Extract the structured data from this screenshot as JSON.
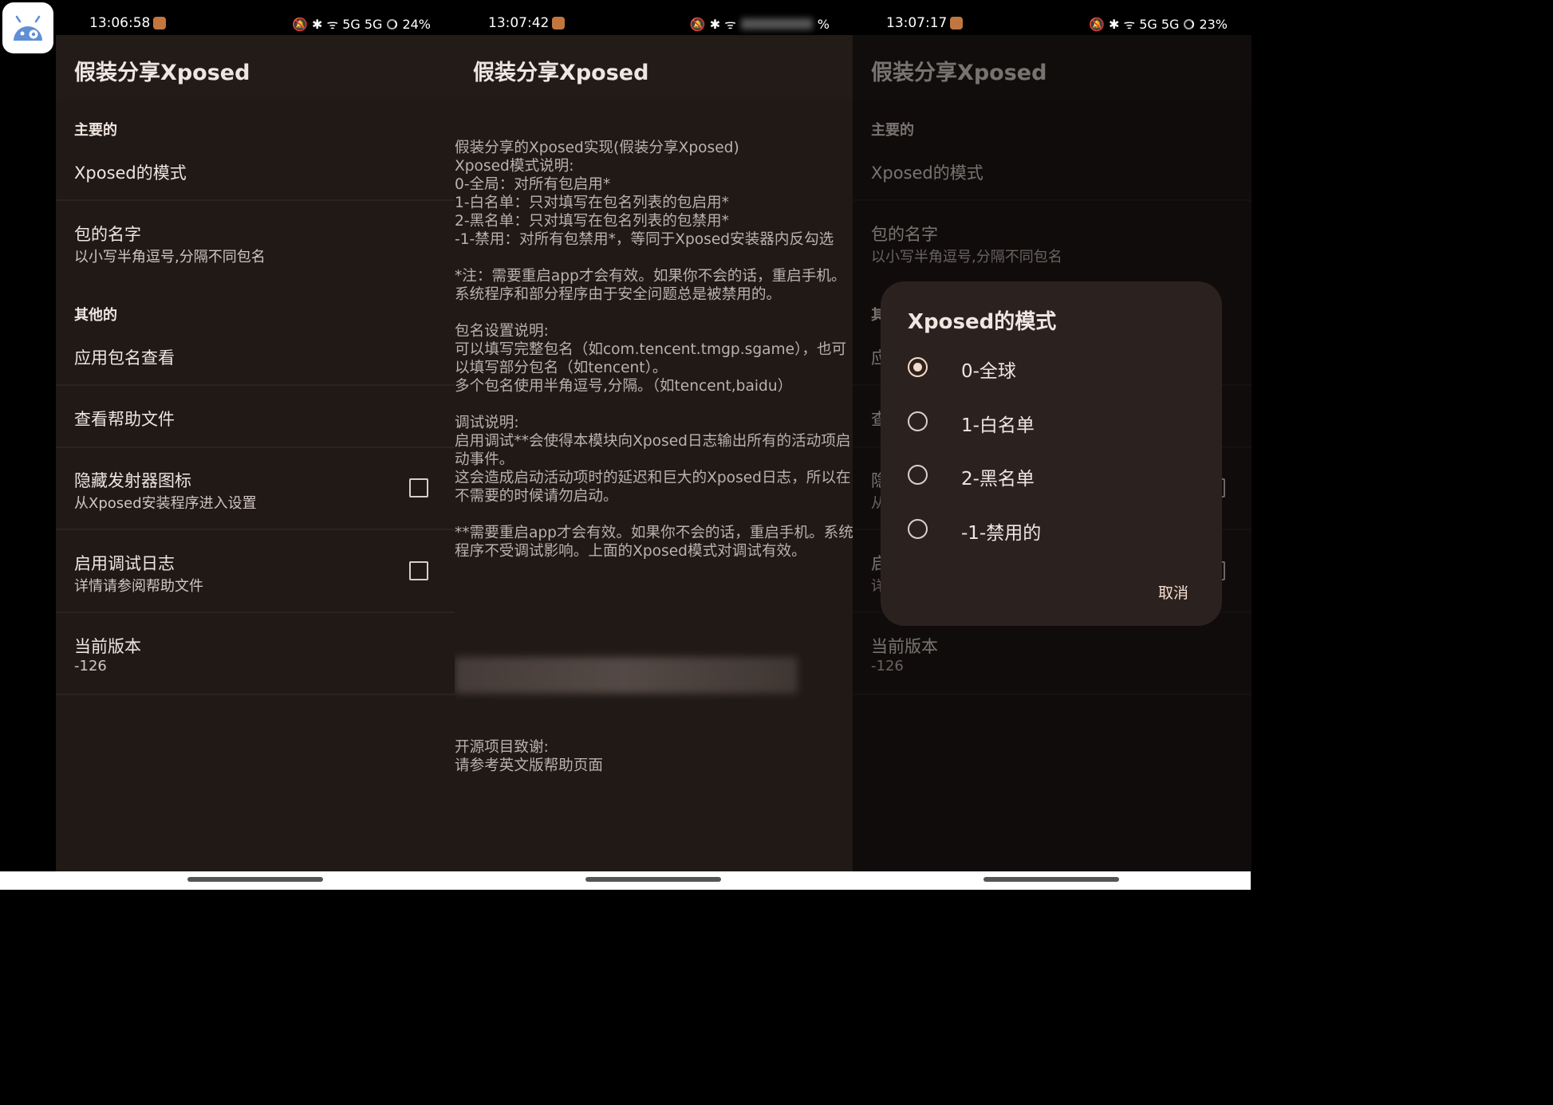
{
  "colors": {
    "background": "#201916",
    "accent": "#f7d9c4",
    "statusbar": "#000000"
  },
  "launcher_icon": {
    "name": "android-settings-icon"
  },
  "screens": [
    {
      "status": {
        "time": "13:06:58",
        "battery": "24%",
        "icons": "🔕 ✱ ᯤ 5G 5G"
      },
      "app_title": "假装分享Xposed",
      "categories": {
        "main": "主要的",
        "other": "其他的"
      },
      "prefs": {
        "mode": {
          "title": "Xposed的模式"
        },
        "package_name": {
          "title": "包的名字",
          "summary": "以小写半角逗号,分隔不同包名"
        },
        "app_package_view": {
          "title": "应用包名查看"
        },
        "help_file": {
          "title": "查看帮助文件"
        },
        "hide_launcher": {
          "title": "隐藏发射器图标",
          "summary": "从Xposed安装程序进入设置",
          "checked": false
        },
        "debug_log": {
          "title": "启用调试日志",
          "summary": "详情请参阅帮助文件",
          "checked": false
        },
        "version": {
          "title": "当前版本",
          "summary": "-126"
        }
      }
    },
    {
      "status": {
        "time": "13:07:42",
        "battery": "%",
        "icons": "🔕 ✱ ᯤ"
      },
      "app_title": "假装分享Xposed",
      "help_text": {
        "p1": "假装分享的Xposed实现(假装分享Xposed)\nXposed模式说明:\n0-全局：对所有包启用*\n1-白名单：只对填写在包名列表的包启用*\n2-黑名单：只对填写在包名列表的包禁用*\n-1-禁用：对所有包禁用*，等同于Xposed安装器内反勾选\n\n*注：需要重启app才会有效。如果你不会的话，重启手机。系统程序和部分程序由于安全问题总是被禁用的。\n\n包名设置说明:\n可以填写完整包名（如com.tencent.tmgp.sgame），也可以填写部分包名（如tencent）。\n多个包名使用半角逗号,分隔。（如tencent,baidu）\n\n调试说明:\n启用调试**会使得本模块向Xposed日志输出所有的活动项启动事件。\n这会造成启动活动项时的延迟和巨大的Xposed日志，所以在不需要的时候请勿启动。\n\n**需要重启app才会有效。如果你不会的话，重启手机。系统程序不受调试影响。上面的Xposed模式对调试有效。",
        "p2": "开源项目致谢:\n请参考英文版帮助页面"
      }
    },
    {
      "status": {
        "time": "13:07:17",
        "battery": "23%",
        "icons": "🔕 ✱ ᯤ 5G 5G"
      },
      "app_title": "假装分享Xposed",
      "dialog": {
        "title": "Xposed的模式",
        "options": [
          "0-全球",
          "1-白名单",
          "2-黑名单",
          "-1-禁用的"
        ],
        "selected_index": 0,
        "cancel": "取消"
      }
    }
  ]
}
